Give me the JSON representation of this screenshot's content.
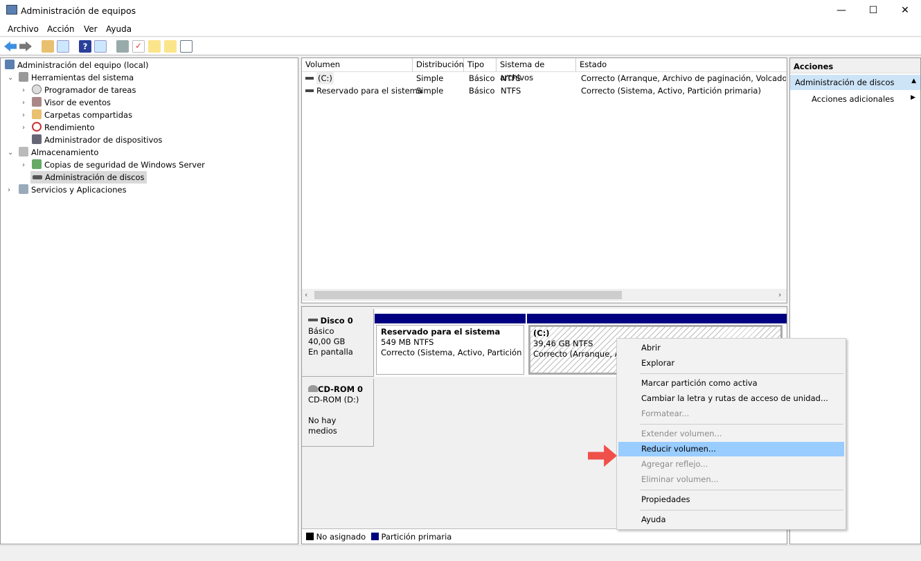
{
  "window": {
    "title": "Administración de equipos",
    "minimize": "—",
    "maximize": "☐",
    "close": "✕"
  },
  "menu": [
    "Archivo",
    "Acción",
    "Ver",
    "Ayuda"
  ],
  "toolbar": [
    "back-icon",
    "forward-icon",
    "up-icon",
    "show-hide-tree-icon",
    "help-icon",
    "show-hide-action-icon",
    "connect-icon",
    "check-icon",
    "export-icon",
    "search-icon",
    "properties-icon"
  ],
  "tree": {
    "root": "Administración del equipo (local)",
    "items": [
      {
        "label": "Herramientas del sistema",
        "level": 1,
        "expanded": true
      },
      {
        "label": "Programador de tareas",
        "level": 2
      },
      {
        "label": "Visor de eventos",
        "level": 2
      },
      {
        "label": "Carpetas compartidas",
        "level": 2
      },
      {
        "label": "Rendimiento",
        "level": 2
      },
      {
        "label": "Administrador de dispositivos",
        "level": 2
      },
      {
        "label": "Almacenamiento",
        "level": 1,
        "expanded": true
      },
      {
        "label": "Copias de seguridad de Windows Server",
        "level": 2
      },
      {
        "label": "Administración de discos",
        "level": 2,
        "selected": true
      },
      {
        "label": "Servicios y Aplicaciones",
        "level": 1
      }
    ]
  },
  "volumes": {
    "columns": [
      "Volumen",
      "Distribución",
      "Tipo",
      "Sistema de archivos",
      "Estado"
    ],
    "rows": [
      [
        "(C:)",
        "Simple",
        "Básico",
        "NTFS",
        "Correcto (Arranque, Archivo de paginación, Volcado, Pa"
      ],
      [
        "Reservado para el sistema",
        "Simple",
        "Básico",
        "NTFS",
        "Correcto (Sistema, Activo, Partición primaria)"
      ]
    ]
  },
  "disks": [
    {
      "name": "Disco 0",
      "type": "Básico",
      "size": "40,00 GB",
      "status": "En pantalla",
      "partitions": [
        {
          "name": "Reservado para el sistema",
          "size": "549 MB NTFS",
          "status": "Correcto (Sistema, Activo, Partición pri"
        },
        {
          "name": "(C:)",
          "size": "39,46 GB NTFS",
          "status": "Correcto (Arranque, Ar"
        }
      ]
    },
    {
      "name": "CD-ROM 0",
      "type": "CD-ROM (D:)",
      "status": "No hay medios"
    }
  ],
  "legend": [
    {
      "label": "No asignado",
      "color": "#000000"
    },
    {
      "label": "Partición primaria",
      "color": "#000080"
    }
  ],
  "actions": {
    "header": "Acciones",
    "section": "Administración de discos",
    "more": "Acciones adicionales"
  },
  "context_menu": [
    {
      "label": "Abrir"
    },
    {
      "label": "Explorar"
    },
    {
      "label": "Marcar partición como activa"
    },
    {
      "label": "Cambiar la letra y rutas de acceso de unidad..."
    },
    {
      "label": "Formatear...",
      "disabled": true
    },
    {
      "label": "Extender volumen...",
      "disabled": true
    },
    {
      "label": "Reducir volumen...",
      "highlighted": true
    },
    {
      "label": "Agregar reflejo...",
      "disabled": true
    },
    {
      "label": "Eliminar volumen...",
      "disabled": true
    },
    {
      "label": "Propiedades"
    },
    {
      "label": "Ayuda"
    }
  ],
  "colors": {
    "primary_partition": "#000080",
    "highlight": "#99ccff",
    "selection": "#cce8ff",
    "arrow": "#f0504a"
  }
}
